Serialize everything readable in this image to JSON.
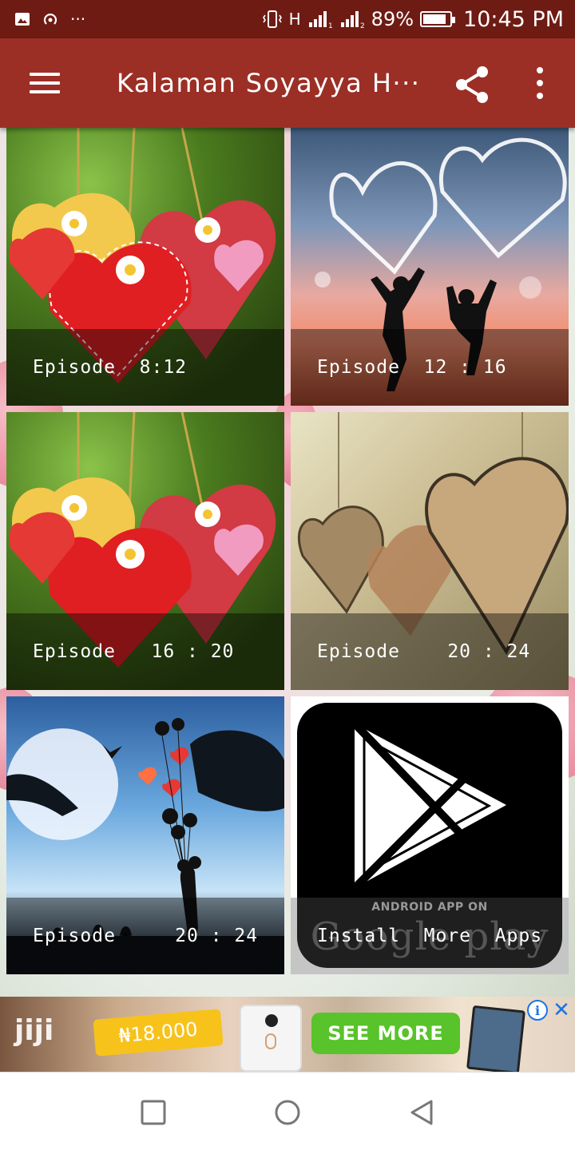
{
  "status_bar": {
    "left_icons": [
      "image-icon",
      "hotspot-icon",
      "more-notifications-icon"
    ],
    "more_notifications": "···",
    "network_type": "H",
    "battery_percent": "89%",
    "battery_level": 0.89,
    "time": "10:45 PM"
  },
  "app_bar": {
    "title": "Kalaman  Soyayya  H···",
    "background_color": "#9b2f26",
    "status_color": "#6e1b14"
  },
  "grid": {
    "tiles": [
      {
        "caption": "Episode  8:12",
        "image": "red-hearts-with-daisies"
      },
      {
        "caption": "Episode  12 : 16",
        "image": "couple-silhouette-glowing-hearts"
      },
      {
        "caption": "Episode   16 : 20",
        "image": "red-hearts-with-daisies"
      },
      {
        "caption": "Episode    20 : 24",
        "image": "wooden-hearts"
      },
      {
        "caption": "Episode     20 : 24",
        "image": "couple-with-heart-balloons"
      },
      {
        "caption": "Install  More  Apps",
        "image": "google-play-store-logo"
      }
    ],
    "store_badge": {
      "subtitle": "ANDROID APP ON",
      "brand": "Google play"
    }
  },
  "ad": {
    "logo": "jiji",
    "price": "₦18.000",
    "cta": "SEE MORE",
    "info_icon": "i",
    "close_icon": "✕"
  },
  "nav_bar": {
    "buttons": [
      "recents-icon",
      "home-icon",
      "back-icon"
    ]
  }
}
